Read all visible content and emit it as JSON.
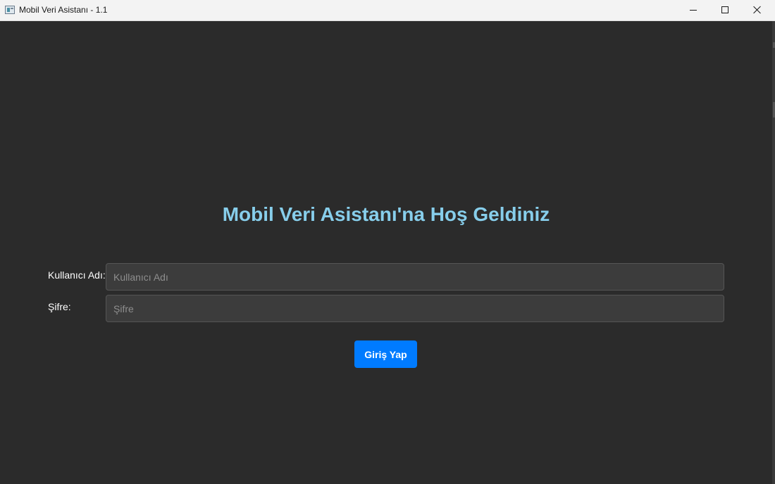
{
  "window": {
    "title": "Mobil Veri Asistanı - 1.1",
    "icon": "app-window-icon",
    "controls": {
      "minimize_icon": "minimize-icon",
      "maximize_icon": "maximize-icon",
      "close_icon": "close-icon"
    }
  },
  "login": {
    "heading": "Mobil Veri Asistanı'na Hoş Geldiniz",
    "username": {
      "label": "Kullanıcı Adı:",
      "placeholder": "Kullanıcı Adı",
      "value": ""
    },
    "password": {
      "label": "Şifre:",
      "placeholder": "Şifre",
      "value": ""
    },
    "submit_label": "Giriş Yap"
  },
  "colors": {
    "background": "#2b2b2b",
    "heading": "#87ceeb",
    "field_bg": "#3c3c3c",
    "button": "#007bff",
    "titlebar": "#f3f3f3"
  }
}
